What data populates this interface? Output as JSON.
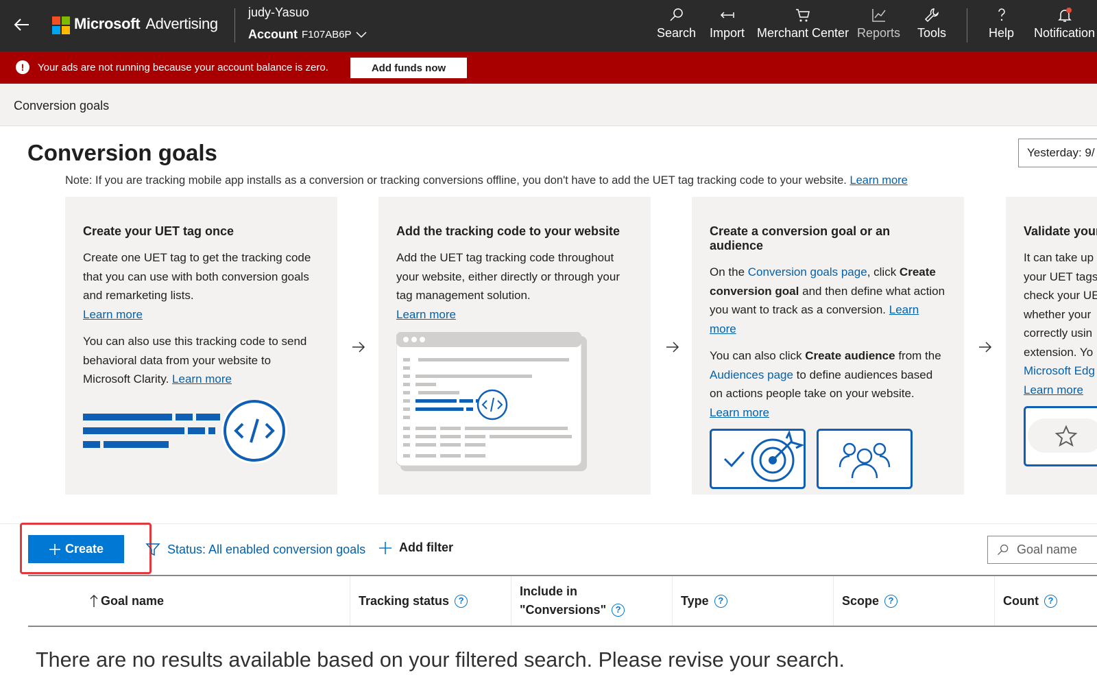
{
  "nav": {
    "brand": "Microsoft",
    "product": "Advertising",
    "account_user": "judy-Yasuo",
    "account_label": "Account",
    "account_id": "F107AB6P",
    "items": [
      {
        "label": "Search",
        "icon": "search-icon"
      },
      {
        "label": "Import",
        "icon": "import-icon"
      },
      {
        "label": "Merchant Center",
        "icon": "cart-icon"
      },
      {
        "label": "Reports",
        "icon": "chart-icon"
      },
      {
        "label": "Tools",
        "icon": "wrench-icon"
      },
      {
        "label": "Help",
        "icon": "help-icon"
      },
      {
        "label": "Notification",
        "icon": "bell-icon"
      }
    ]
  },
  "banner": {
    "message": "Your ads are not running because your account balance is zero.",
    "button": "Add funds now"
  },
  "breadcrumb": "Conversion goals",
  "page": {
    "title": "Conversion goals",
    "date_range": "Yesterday: 9/"
  },
  "note": {
    "text": "Note: If you are tracking mobile app installs as a conversion or tracking conversions offline, you don't have to add the UET tag tracking code to your website.",
    "link": "Learn more"
  },
  "cards": [
    {
      "title": "Create your UET tag once",
      "p1": "Create one UET tag to get the tracking code that you can use with both conversion goals and remarketing lists.",
      "p1_link": "Learn more",
      "p2": "You can also use this tracking code to send behavioral data from your website to Microsoft Clarity.",
      "p2_link": "Learn more"
    },
    {
      "title": "Add the tracking code to your website",
      "p1": "Add the UET tag tracking code throughout your website, either directly or through your tag management solution.",
      "p1_link": "Learn more"
    },
    {
      "title": "Create a conversion goal or an audience",
      "p1_a": "On the",
      "p1_link1": "Conversion goals page",
      "p1_b": ", click",
      "p1_bold": "Create conversion goal",
      "p1_c": "and then define what action you want to track as a conversion.",
      "p1_link2": "Learn more",
      "p2_a": "You can also click",
      "p2_bold": "Create audience",
      "p2_b": "from the",
      "p2_link1": "Audiences page",
      "p2_c": "to define audiences based on actions people take on your website.",
      "p2_link2": "Learn more"
    },
    {
      "title": "Validate your",
      "lines": [
        "It can take up",
        "your UET tags",
        "check your UE",
        "whether your",
        "correctly usin",
        "extension. Yo"
      ],
      "link1": "Microsoft Edg",
      "link2": "Learn more"
    }
  ],
  "toolbar": {
    "create": "Create",
    "status_filter": "Status: All enabled conversion goals",
    "add_filter": "Add filter",
    "search_placeholder": "Goal name"
  },
  "table": {
    "columns": [
      "Goal name",
      "Tracking status",
      "Include in \"Conversions\"",
      "Type",
      "Scope",
      "Count"
    ],
    "col_include_1": "Include in",
    "col_include_2": "\"Conversions\"",
    "empty_message": "There are no results available based on your filtered search. Please revise your search."
  },
  "colors": {
    "nav_bg": "#2b2b2b",
    "banner_bg": "#a80000",
    "primary": "#0078d4",
    "link": "#0062ad",
    "highlight": "#e0393e"
  }
}
